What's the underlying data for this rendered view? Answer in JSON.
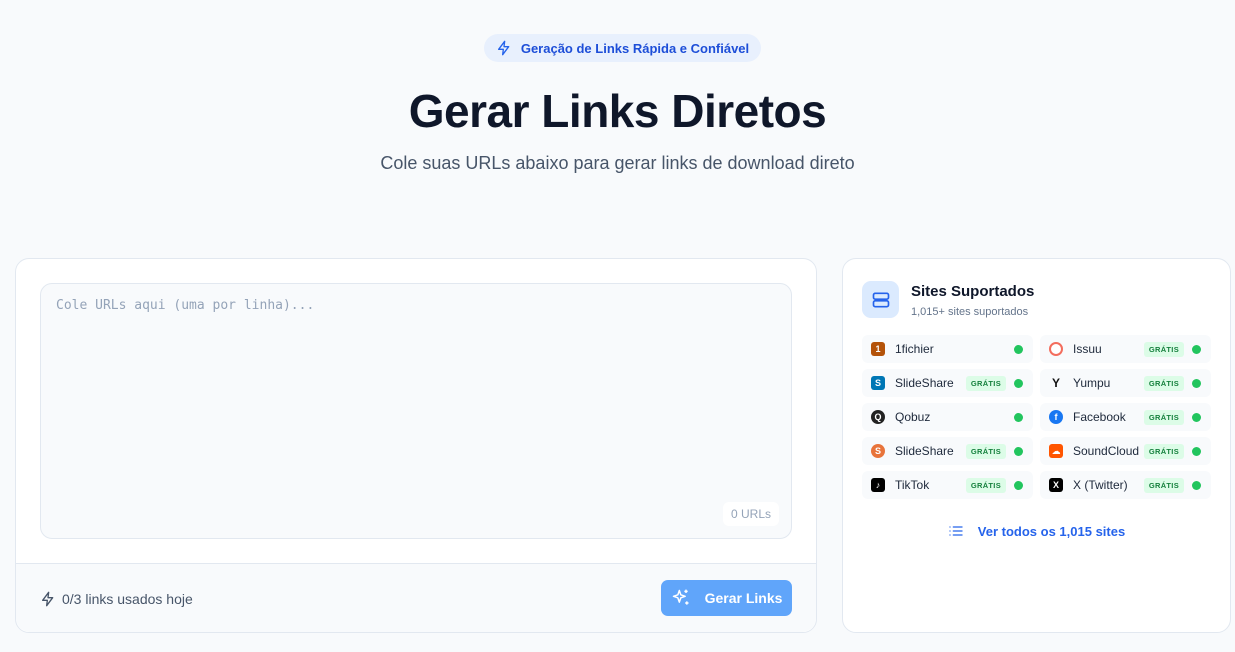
{
  "badge": {
    "label": "Geração de Links Rápida e Confiável"
  },
  "hero": {
    "title": "Gerar Links Diretos",
    "subtitle": "Cole suas URLs abaixo para gerar links de download direto"
  },
  "input": {
    "placeholder": "Cole URLs aqui (uma por linha)...",
    "value": "",
    "count_label": "0 URLs"
  },
  "footer": {
    "usage": "0/3 links usados hoje",
    "generate_label": "Gerar Links"
  },
  "sidebar": {
    "title": "Sites Suportados",
    "subtitle": "1,015+ sites suportados",
    "free_label": "GRÁTIS",
    "see_all": "Ver todos os 1,015 sites",
    "sites": [
      {
        "name": "1fichier",
        "free": false,
        "icon": "1fichier-icon",
        "color": "#b45309"
      },
      {
        "name": "Issuu",
        "free": true,
        "icon": "issuu-icon",
        "color": "#f36d5d"
      },
      {
        "name": "SlideShare",
        "free": true,
        "icon": "slideshare-icon",
        "color": "#0077b5"
      },
      {
        "name": "Yumpu",
        "free": true,
        "icon": "yumpu-icon",
        "color": "#111111"
      },
      {
        "name": "Qobuz",
        "free": false,
        "icon": "qobuz-icon",
        "color": "#222222"
      },
      {
        "name": "Facebook",
        "free": true,
        "icon": "facebook-icon",
        "color": "#1877f2"
      },
      {
        "name": "SlideShare",
        "free": true,
        "icon": "slideshare-icon",
        "color": "#e8743b"
      },
      {
        "name": "SoundCloud",
        "free": true,
        "icon": "soundcloud-icon",
        "color": "#ff5500"
      },
      {
        "name": "TikTok",
        "free": true,
        "icon": "tiktok-icon",
        "color": "#000000"
      },
      {
        "name": "X (Twitter)",
        "free": true,
        "icon": "x-twitter-icon",
        "color": "#000000"
      }
    ]
  },
  "colors": {
    "accent": "#2563eb",
    "button": "#60a5fa",
    "online": "#22c55e"
  }
}
